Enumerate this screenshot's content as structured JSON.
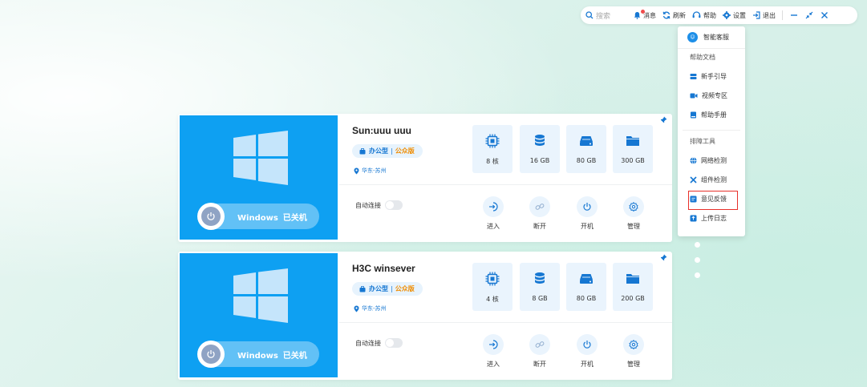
{
  "toolbar": {
    "search_placeholder": "搜索",
    "message_label": "消息",
    "refresh_label": "刷新",
    "help_label": "帮助",
    "settings_label": "设置",
    "logout_label": "退出"
  },
  "help_menu": {
    "header": "智能客服",
    "section_docs": "帮助文档",
    "docs_items": [
      "新手引导",
      "视频专区",
      "帮助手册"
    ],
    "section_tools": "排障工具",
    "tools_items": [
      "网络检测",
      "组件检测",
      "意见反馈",
      "上传日志"
    ],
    "highlighted_item": "意见反馈"
  },
  "vms": [
    {
      "name": "Sun:uuu uuu",
      "tag_type": "办公型",
      "tag_separator": "|",
      "tag_edition": "公众版",
      "location": "华东-苏州",
      "os": "Windows",
      "status": "已关机",
      "cpu": "8 核",
      "memory": "16 GB",
      "disk1": "80 GB",
      "disk2": "300 GB",
      "auto_connect_label": "自动连接",
      "auto_connect": false,
      "actions": [
        "进入",
        "断开",
        "开机",
        "管理"
      ]
    },
    {
      "name": "H3C winsever",
      "tag_type": "办公型",
      "tag_separator": "|",
      "tag_edition": "公众版",
      "location": "华东-苏州",
      "os": "Windows",
      "status": "已关机",
      "cpu": "4 核",
      "memory": "8 GB",
      "disk1": "80 GB",
      "disk2": "200 GB",
      "auto_connect_label": "自动连接",
      "auto_connect": false,
      "actions": [
        "进入",
        "断开",
        "开机",
        "管理"
      ]
    }
  ],
  "colors": {
    "primary": "#1677d2",
    "thumbnail": "#0ea0f2",
    "accent_orange": "#f08c00",
    "highlight_border": "#e8302a",
    "notification_dot": "#f04b4b"
  }
}
